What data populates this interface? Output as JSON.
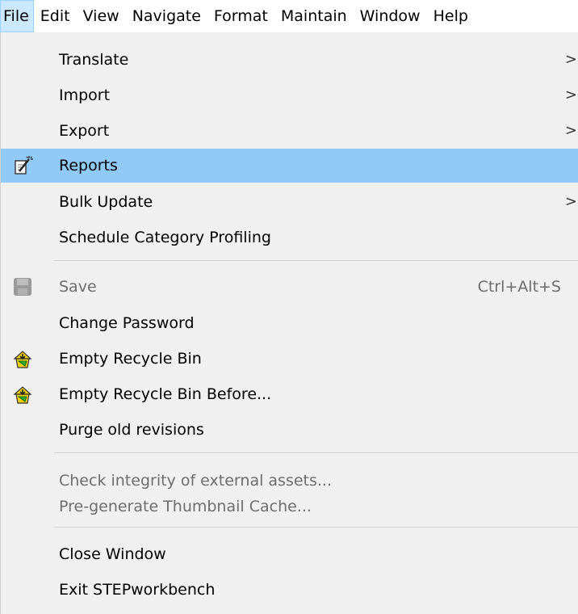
{
  "menubar": {
    "items": [
      "File",
      "Edit",
      "View",
      "Navigate",
      "Format",
      "Maintain",
      "Window",
      "Help"
    ]
  },
  "file_menu": {
    "translate": "Translate",
    "import": "Import",
    "export": "Export",
    "reports": "Reports",
    "bulk_update": "Bulk Update",
    "schedule_category_profiling": "Schedule Category Profiling",
    "save": "Save",
    "save_shortcut": "Ctrl+Alt+S",
    "change_password": "Change Password",
    "empty_recycle_bin": "Empty Recycle Bin",
    "empty_recycle_bin_before": "Empty Recycle Bin Before...",
    "purge_old_revisions": "Purge old revisions",
    "check_integrity": "Check integrity of external assets...",
    "pregenerate_thumbnail": "Pre-generate Thumbnail Cache...",
    "close_window": "Close Window",
    "exit": "Exit STEPworkbench",
    "submenu_arrow": ">"
  },
  "icons": {
    "reports": "report-wand-icon",
    "save": "save-disk-icon",
    "recycle": "recycle-bin-icon"
  },
  "colors": {
    "menu_background": "#f0f0f0",
    "highlight": "#91c9f7",
    "active_menubar": "#cce8ff",
    "disabled_text": "#6d6d6d"
  }
}
